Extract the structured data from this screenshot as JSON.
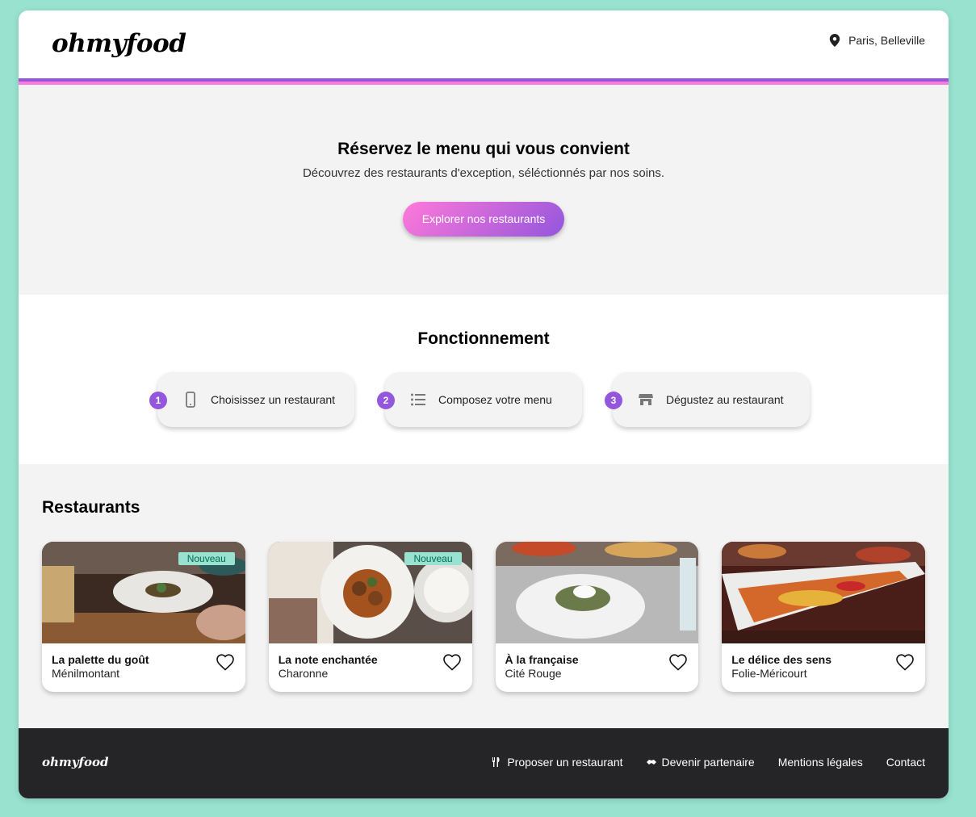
{
  "brand": {
    "logo": "ohmyfood",
    "accent": "#9356dc",
    "accent2": "#ff79da",
    "secondary": "#99e2d0"
  },
  "header": {
    "location": "Paris, Belleville",
    "location_icon": "map-pin-icon"
  },
  "hero": {
    "title": "Réservez le menu qui vous convient",
    "subtitle": "Découvrez des restaurants d'exception, séléctionnés par nos soins.",
    "cta": "Explorer nos restaurants"
  },
  "how": {
    "title": "Fonctionnement",
    "steps": [
      {
        "num": "1",
        "label": "Choisissez un restaurant",
        "icon": "mobile-phone-icon"
      },
      {
        "num": "2",
        "label": "Composez votre menu",
        "icon": "list-icon"
      },
      {
        "num": "3",
        "label": "Dégustez au restaurant",
        "icon": "store-icon"
      }
    ]
  },
  "restaurants": {
    "title": "Restaurants",
    "items": [
      {
        "name": "La palette du goût",
        "location": "Ménilmontant",
        "badge": "Nouveau"
      },
      {
        "name": "La note enchantée",
        "location": "Charonne",
        "badge": "Nouveau"
      },
      {
        "name": "À la française",
        "location": "Cité Rouge"
      },
      {
        "name": "Le délice des sens",
        "location": "Folie-Méricourt"
      }
    ]
  },
  "footer": {
    "logo": "ohmyfood",
    "links": [
      {
        "label": "Proposer un restaurant",
        "icon": "utensils-icon"
      },
      {
        "label": "Devenir partenaire",
        "icon": "handshake-icon"
      },
      {
        "label": "Mentions légales"
      },
      {
        "label": "Contact"
      }
    ]
  }
}
